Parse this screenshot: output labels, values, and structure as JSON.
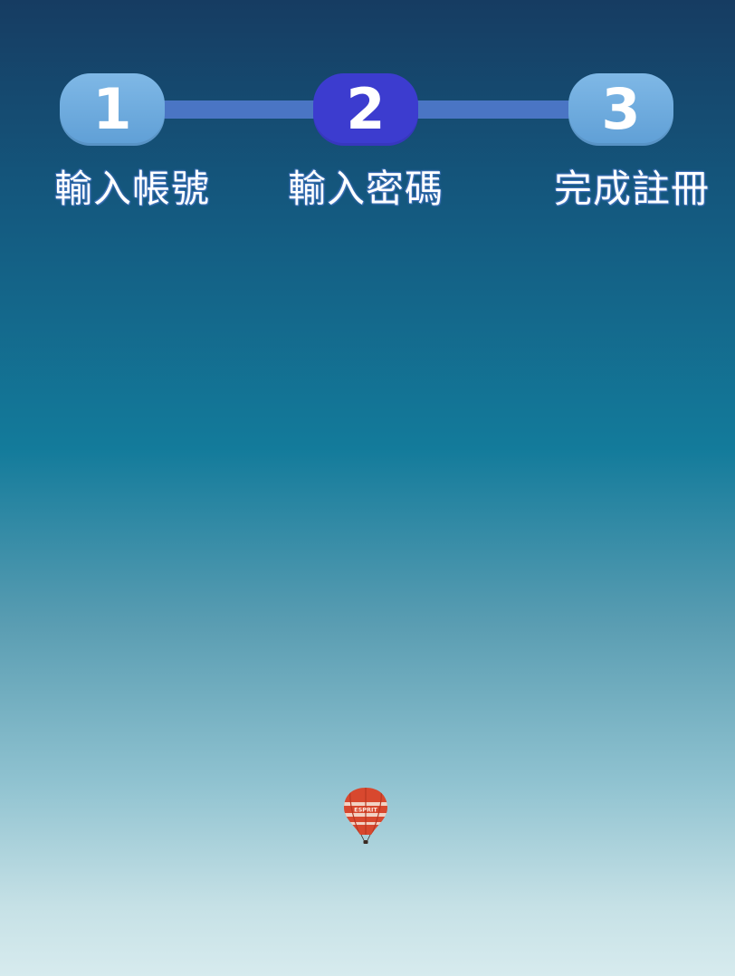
{
  "stepper": {
    "steps": [
      {
        "number": "1",
        "label": "輸入帳號",
        "state": "inactive"
      },
      {
        "number": "2",
        "label": "輸入密碼",
        "state": "active"
      },
      {
        "number": "3",
        "label": "完成註冊",
        "state": "inactive"
      }
    ]
  },
  "colors": {
    "active_step": "#3c3ccf",
    "inactive_step": "#6aaae0",
    "connector": "#4a75c4",
    "background_top": "#163c62",
    "background_bottom": "#d7ebee"
  },
  "background": {
    "scene": "sky gradient with hot air balloon",
    "balloon_text": "ESPRIT"
  }
}
